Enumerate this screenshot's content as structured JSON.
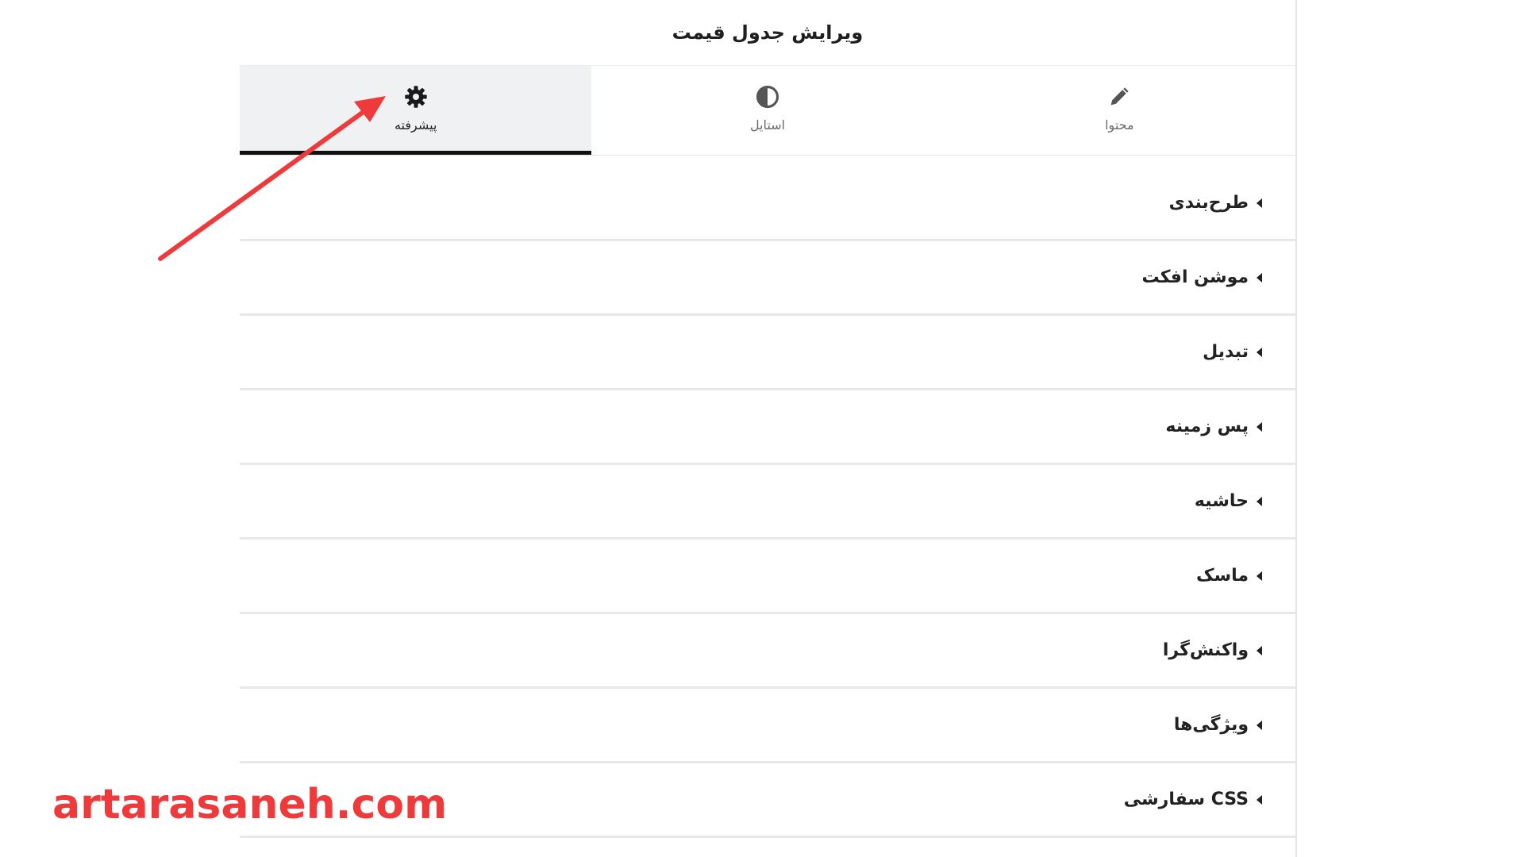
{
  "panel": {
    "title": "ویرایش جدول قیمت"
  },
  "tabs": [
    {
      "label": "محتوا",
      "icon": "pencil-icon",
      "active": false
    },
    {
      "label": "استایل",
      "icon": "contrast-icon",
      "active": false
    },
    {
      "label": "پیشرفته",
      "icon": "gear-icon",
      "active": true
    }
  ],
  "sections": [
    {
      "label": "طرح‌بندی"
    },
    {
      "label": "موشن افکت"
    },
    {
      "label": "تبدیل"
    },
    {
      "label": "پس زمینه"
    },
    {
      "label": "حاشیه"
    },
    {
      "label": "ماسک"
    },
    {
      "label": "واکنش‌گرا"
    },
    {
      "label": "ویژگی‌ها"
    },
    {
      "label": "CSS سفارشی"
    }
  ],
  "annotation": {
    "color": "#ee3a3b"
  },
  "watermark": {
    "text": "artarasaneh.com"
  }
}
